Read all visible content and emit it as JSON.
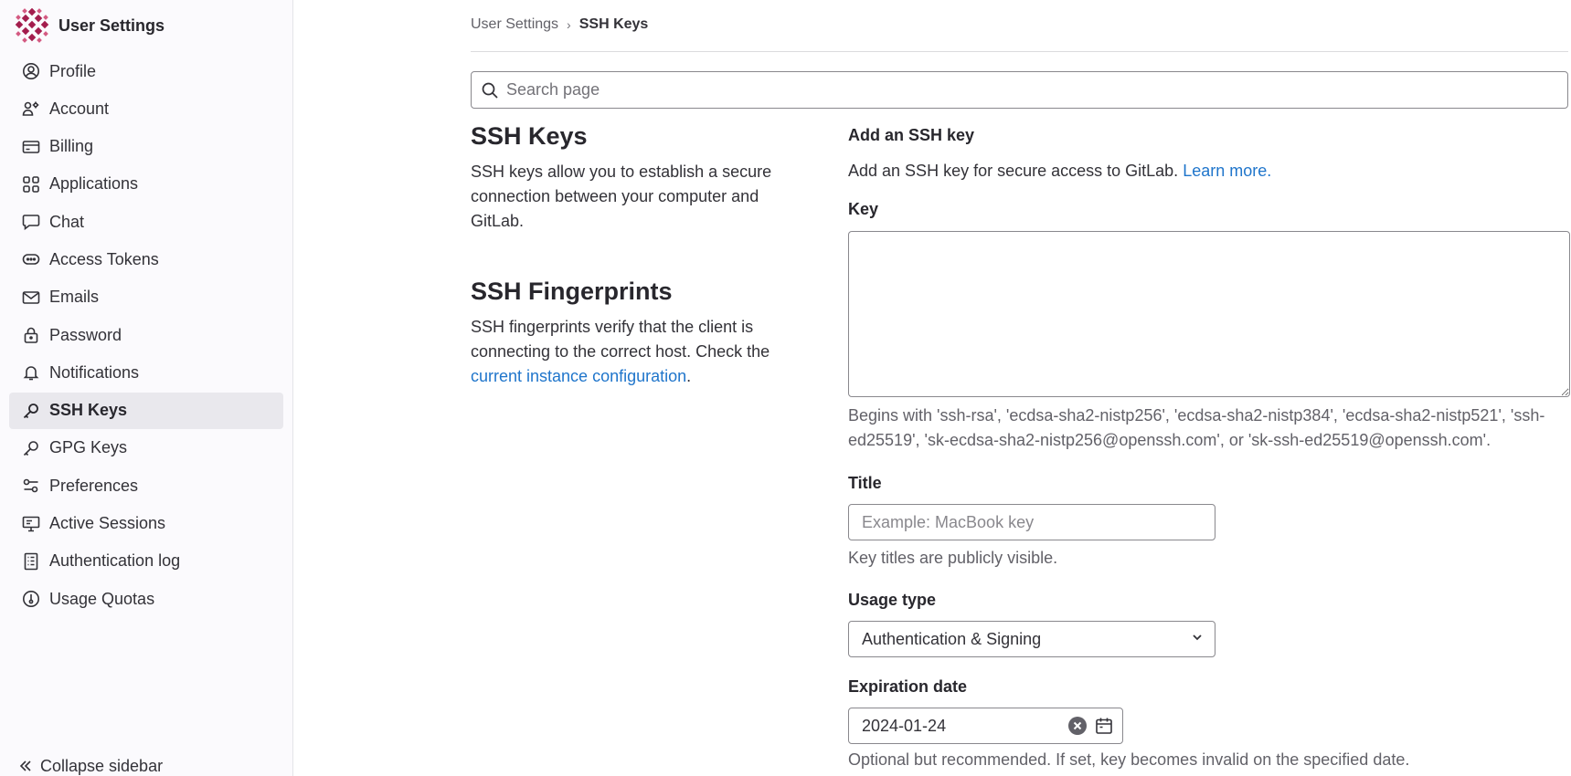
{
  "sidebar": {
    "title": "User Settings",
    "items": [
      {
        "label": "Profile",
        "icon": "profile-icon"
      },
      {
        "label": "Account",
        "icon": "account-icon"
      },
      {
        "label": "Billing",
        "icon": "billing-icon"
      },
      {
        "label": "Applications",
        "icon": "applications-icon"
      },
      {
        "label": "Chat",
        "icon": "chat-icon"
      },
      {
        "label": "Access Tokens",
        "icon": "token-icon"
      },
      {
        "label": "Emails",
        "icon": "mail-icon"
      },
      {
        "label": "Password",
        "icon": "lock-icon"
      },
      {
        "label": "Notifications",
        "icon": "bell-icon"
      },
      {
        "label": "SSH Keys",
        "icon": "key-icon",
        "active": true
      },
      {
        "label": "GPG Keys",
        "icon": "key-icon"
      },
      {
        "label": "Preferences",
        "icon": "preferences-icon"
      },
      {
        "label": "Active Sessions",
        "icon": "monitor-icon"
      },
      {
        "label": "Authentication log",
        "icon": "log-icon"
      },
      {
        "label": "Usage Quotas",
        "icon": "gauge-icon"
      }
    ],
    "collapse_label": "Collapse sidebar"
  },
  "breadcrumb": {
    "parent": "User Settings",
    "separator": "›",
    "current": "SSH Keys"
  },
  "search": {
    "placeholder": "Search page"
  },
  "info": {
    "ssh_keys_title": "SSH Keys",
    "ssh_keys_desc": "SSH keys allow you to establish a secure connection between your computer and GitLab.",
    "fingerprints_title": "SSH Fingerprints",
    "fingerprints_desc": "SSH fingerprints verify that the client is connecting to the correct host. Check the ",
    "fingerprints_link": "current instance configuration",
    "fingerprints_end": "."
  },
  "form": {
    "title": "Add an SSH key",
    "desc": "Add an SSH key for secure access to GitLab. ",
    "learn_more": "Learn more.",
    "key_label": "Key",
    "key_value": "",
    "key_help": "Begins with 'ssh-rsa', 'ecdsa-sha2-nistp256', 'ecdsa-sha2-nistp384', 'ecdsa-sha2-nistp521', 'ssh-ed25519', 'sk-ecdsa-sha2-nistp256@openssh.com', or 'sk-ssh-ed25519@openssh.com'.",
    "title_label": "Title",
    "title_placeholder": "Example: MacBook key",
    "title_help": "Key titles are publicly visible.",
    "usage_label": "Usage type",
    "usage_value": "Authentication & Signing",
    "expiration_label": "Expiration date",
    "expiration_value": "2024-01-24",
    "expiration_help": "Optional but recommended. If set, key becomes invalid on the specified date."
  },
  "colors": {
    "logo": "#a31d4d",
    "link": "#1f75cb",
    "active_bg": "#e9e8ed"
  }
}
